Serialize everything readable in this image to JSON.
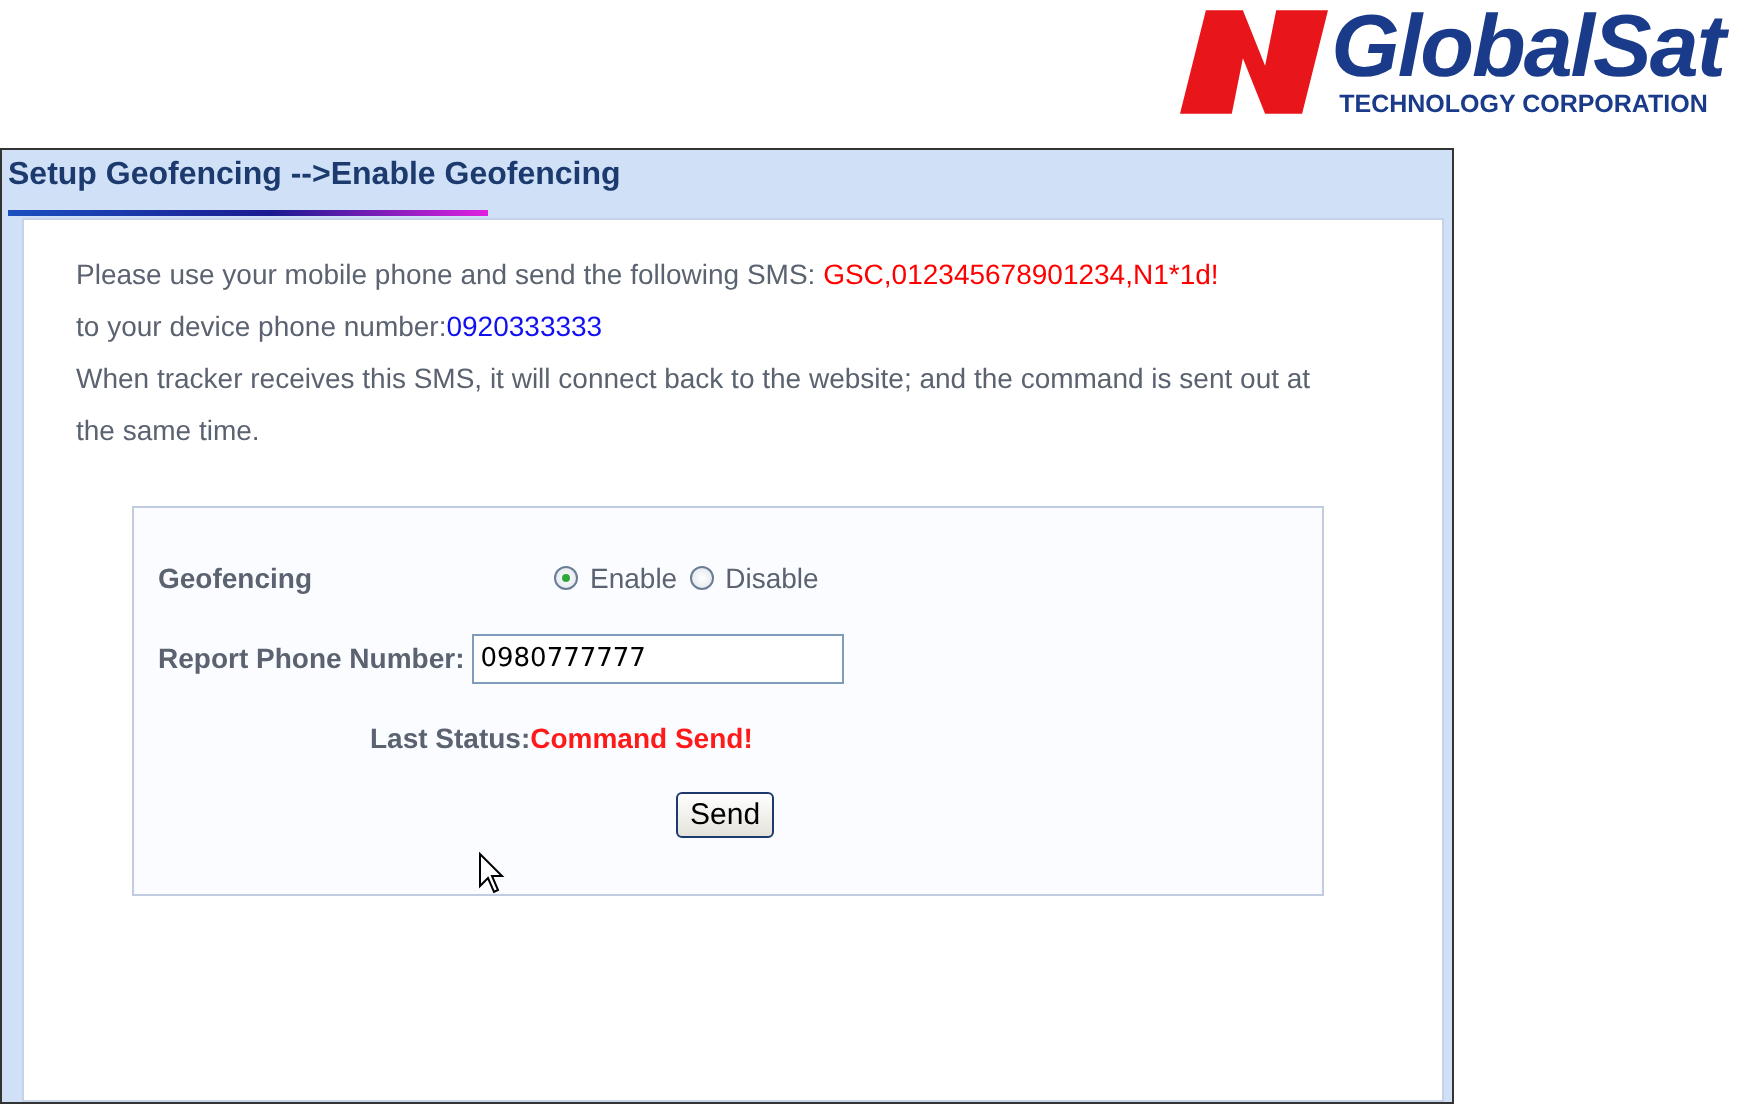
{
  "logo": {
    "name": "GlobalSat",
    "subtitle": "TECHNOLOGY CORPORATION"
  },
  "panel": {
    "title": "Setup Geofencing -->Enable Geofencing"
  },
  "instructions": {
    "sms_prefix": "Please use your mobile phone and send the following SMS:",
    "sms_command": "GSC,012345678901234,N1*1d!",
    "phone_prefix": "to your device phone number:",
    "device_phone": "0920333333",
    "note": "When tracker receives this SMS, it will connect back to the website; and the command is sent out at the same time."
  },
  "form": {
    "geofencing_label": "Geofencing",
    "options": [
      {
        "label": "Enable",
        "selected": true
      },
      {
        "label": "Disable",
        "selected": false
      }
    ],
    "report_label": "Report Phone Number:",
    "report_value": "0980777777",
    "status_label": "Last Status:",
    "status_value": "Command Send!",
    "button": "Send"
  }
}
